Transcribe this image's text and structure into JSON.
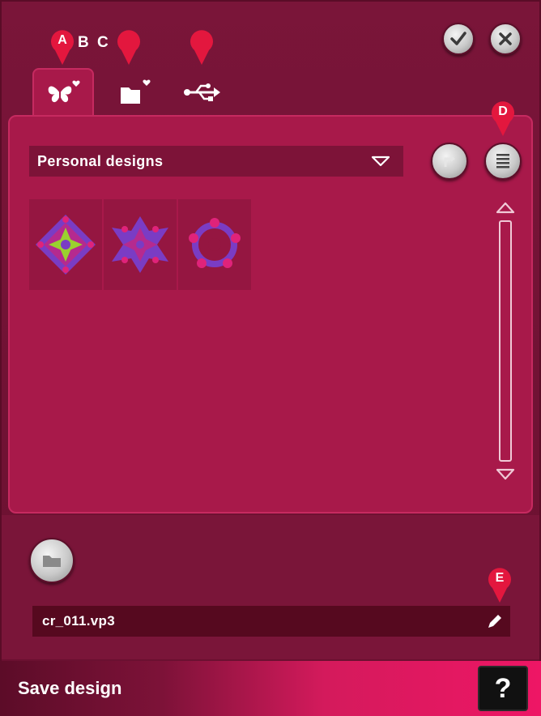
{
  "window": {
    "footer_title": "Save design",
    "help_label": "?"
  },
  "header": {
    "confirm_icon": "check-icon",
    "cancel_icon": "close-icon"
  },
  "tabs": [
    {
      "icon": "personal-designs-icon",
      "active": true
    },
    {
      "icon": "personal-files-icon",
      "active": false
    },
    {
      "icon": "usb-icon",
      "active": false
    }
  ],
  "callouts": {
    "a": "A",
    "b": "B",
    "c": "C",
    "d": "D",
    "e": "E"
  },
  "browser": {
    "folder_dropdown_value": "Personal designs",
    "designs": [
      {
        "name": "design-1"
      },
      {
        "name": "design-2"
      },
      {
        "name": "design-3"
      }
    ]
  },
  "save": {
    "filename": "cr_011.vp3"
  },
  "colors": {
    "background": "#7a1539",
    "panel": "#a8194a",
    "callout": "#e3173e",
    "footer_accent": "#ee1665"
  }
}
